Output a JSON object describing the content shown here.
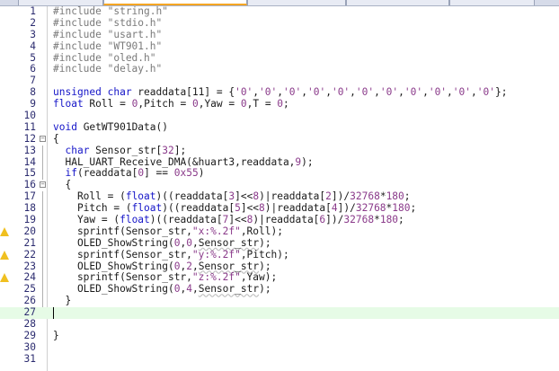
{
  "editor": {
    "lines": [
      {
        "n": "1",
        "tokens": [
          {
            "c": "pp",
            "t": "#include \"string.h\""
          }
        ]
      },
      {
        "n": "2",
        "tokens": [
          {
            "c": "pp",
            "t": "#include \"stdio.h\""
          }
        ]
      },
      {
        "n": "3",
        "tokens": [
          {
            "c": "pp",
            "t": "#include \"usart.h\""
          }
        ]
      },
      {
        "n": "4",
        "tokens": [
          {
            "c": "pp",
            "t": "#include \"WT901.h\""
          }
        ]
      },
      {
        "n": "5",
        "tokens": [
          {
            "c": "pp",
            "t": "#include \"oled.h\""
          }
        ]
      },
      {
        "n": "6",
        "tokens": [
          {
            "c": "pp",
            "t": "#include \"delay.h\""
          }
        ]
      },
      {
        "n": "7",
        "tokens": []
      },
      {
        "n": "8",
        "tokens": [
          {
            "c": "kw",
            "t": "unsigned char "
          },
          {
            "c": "pl",
            "t": "readdata[11] = {"
          },
          {
            "c": "str",
            "t": "'0'"
          },
          {
            "c": "pl",
            "t": ","
          },
          {
            "c": "str",
            "t": "'0'"
          },
          {
            "c": "pl",
            "t": ","
          },
          {
            "c": "str",
            "t": "'0'"
          },
          {
            "c": "pl",
            "t": ","
          },
          {
            "c": "str",
            "t": "'0'"
          },
          {
            "c": "pl",
            "t": ","
          },
          {
            "c": "str",
            "t": "'0'"
          },
          {
            "c": "pl",
            "t": ","
          },
          {
            "c": "str",
            "t": "'0'"
          },
          {
            "c": "pl",
            "t": ","
          },
          {
            "c": "str",
            "t": "'0'"
          },
          {
            "c": "pl",
            "t": ","
          },
          {
            "c": "str",
            "t": "'0'"
          },
          {
            "c": "pl",
            "t": ","
          },
          {
            "c": "str",
            "t": "'0'"
          },
          {
            "c": "pl",
            "t": ","
          },
          {
            "c": "str",
            "t": "'0'"
          },
          {
            "c": "pl",
            "t": ","
          },
          {
            "c": "str",
            "t": "'0'"
          },
          {
            "c": "pl",
            "t": "};"
          }
        ]
      },
      {
        "n": "9",
        "tokens": [
          {
            "c": "kw",
            "t": "float "
          },
          {
            "c": "pl",
            "t": "Roll = "
          },
          {
            "c": "num",
            "t": "0"
          },
          {
            "c": "pl",
            "t": ",Pitch = "
          },
          {
            "c": "num",
            "t": "0"
          },
          {
            "c": "pl",
            "t": ",Yaw = "
          },
          {
            "c": "num",
            "t": "0"
          },
          {
            "c": "pl",
            "t": ",T = "
          },
          {
            "c": "num",
            "t": "0"
          },
          {
            "c": "pl",
            "t": ";"
          }
        ]
      },
      {
        "n": "10",
        "tokens": []
      },
      {
        "n": "11",
        "tokens": [
          {
            "c": "kw",
            "t": "void "
          },
          {
            "c": "pl",
            "t": "GetWT901Data()"
          }
        ]
      },
      {
        "n": "12",
        "fold": "open",
        "tokens": [
          {
            "c": "pl",
            "t": "{"
          }
        ]
      },
      {
        "n": "13",
        "bar": true,
        "tokens": [
          {
            "c": "pl",
            "t": "  "
          },
          {
            "c": "kw",
            "t": "char "
          },
          {
            "c": "pl",
            "t": "Sensor_str["
          },
          {
            "c": "num",
            "t": "32"
          },
          {
            "c": "pl",
            "t": "];"
          }
        ]
      },
      {
        "n": "14",
        "bar": true,
        "tokens": [
          {
            "c": "pl",
            "t": "  HAL_UART_Receive_DMA(&huart3,readdata,"
          },
          {
            "c": "num",
            "t": "9"
          },
          {
            "c": "pl",
            "t": ");"
          }
        ]
      },
      {
        "n": "15",
        "bar": true,
        "tokens": [
          {
            "c": "pl",
            "t": "  "
          },
          {
            "c": "kw",
            "t": "if"
          },
          {
            "c": "pl",
            "t": "(readdata["
          },
          {
            "c": "num",
            "t": "0"
          },
          {
            "c": "pl",
            "t": "] == "
          },
          {
            "c": "num",
            "t": "0x55"
          },
          {
            "c": "pl",
            "t": ")"
          }
        ]
      },
      {
        "n": "16",
        "fold": "open",
        "tokens": [
          {
            "c": "pl",
            "t": "  {"
          }
        ]
      },
      {
        "n": "17",
        "bar": true,
        "tokens": [
          {
            "c": "pl",
            "t": "    Roll = ("
          },
          {
            "c": "kw",
            "t": "float"
          },
          {
            "c": "pl",
            "t": ")((readdata["
          },
          {
            "c": "num",
            "t": "3"
          },
          {
            "c": "pl",
            "t": "]<<"
          },
          {
            "c": "num",
            "t": "8"
          },
          {
            "c": "pl",
            "t": ")|readdata["
          },
          {
            "c": "num",
            "t": "2"
          },
          {
            "c": "pl",
            "t": "])/"
          },
          {
            "c": "num",
            "t": "32768"
          },
          {
            "c": "pl",
            "t": "*"
          },
          {
            "c": "num",
            "t": "180"
          },
          {
            "c": "pl",
            "t": ";"
          }
        ]
      },
      {
        "n": "18",
        "bar": true,
        "tokens": [
          {
            "c": "pl",
            "t": "    Pitch = ("
          },
          {
            "c": "kw",
            "t": "float"
          },
          {
            "c": "pl",
            "t": ")((readdata["
          },
          {
            "c": "num",
            "t": "5"
          },
          {
            "c": "pl",
            "t": "]<<"
          },
          {
            "c": "num",
            "t": "8"
          },
          {
            "c": "pl",
            "t": ")|readdata["
          },
          {
            "c": "num",
            "t": "4"
          },
          {
            "c": "pl",
            "t": "])/"
          },
          {
            "c": "num",
            "t": "32768"
          },
          {
            "c": "pl",
            "t": "*"
          },
          {
            "c": "num",
            "t": "180"
          },
          {
            "c": "pl",
            "t": ";"
          }
        ]
      },
      {
        "n": "19",
        "bar": true,
        "tokens": [
          {
            "c": "pl",
            "t": "    Yaw = ("
          },
          {
            "c": "kw",
            "t": "float"
          },
          {
            "c": "pl",
            "t": ")((readdata["
          },
          {
            "c": "num",
            "t": "7"
          },
          {
            "c": "pl",
            "t": "]<<"
          },
          {
            "c": "num",
            "t": "8"
          },
          {
            "c": "pl",
            "t": ")|readdata["
          },
          {
            "c": "num",
            "t": "6"
          },
          {
            "c": "pl",
            "t": "])/"
          },
          {
            "c": "num",
            "t": "32768"
          },
          {
            "c": "pl",
            "t": "*"
          },
          {
            "c": "num",
            "t": "180"
          },
          {
            "c": "pl",
            "t": ";"
          }
        ]
      },
      {
        "n": "20",
        "bar": true,
        "warn": true,
        "tokens": [
          {
            "c": "pl",
            "t": "    sprintf(Sensor_str,"
          },
          {
            "c": "str",
            "t": "\"x:%.2f\""
          },
          {
            "c": "pl",
            "t": ",Roll);"
          }
        ]
      },
      {
        "n": "21",
        "bar": true,
        "tokens": [
          {
            "c": "pl",
            "t": "    OLED_ShowString("
          },
          {
            "c": "num",
            "t": "0"
          },
          {
            "c": "pl",
            "t": ","
          },
          {
            "c": "num",
            "t": "0"
          },
          {
            "c": "pl",
            "t": ","
          },
          {
            "c": "sq",
            "t": "Sensor_str"
          },
          {
            "c": "pl",
            "t": ");"
          }
        ]
      },
      {
        "n": "22",
        "bar": true,
        "warn": true,
        "tokens": [
          {
            "c": "pl",
            "t": "    sprintf(Sensor_str,"
          },
          {
            "c": "str",
            "t": "\"y:%.2f\""
          },
          {
            "c": "pl",
            "t": ",Pitch);"
          }
        ]
      },
      {
        "n": "23",
        "bar": true,
        "tokens": [
          {
            "c": "pl",
            "t": "    OLED_ShowString("
          },
          {
            "c": "num",
            "t": "0"
          },
          {
            "c": "pl",
            "t": ","
          },
          {
            "c": "num",
            "t": "2"
          },
          {
            "c": "pl",
            "t": ","
          },
          {
            "c": "sq",
            "t": "Sensor_str"
          },
          {
            "c": "pl",
            "t": ");"
          }
        ]
      },
      {
        "n": "24",
        "bar": true,
        "warn": true,
        "tokens": [
          {
            "c": "pl",
            "t": "    sprintf(Sensor_str,"
          },
          {
            "c": "str",
            "t": "\"z:%.2f\""
          },
          {
            "c": "pl",
            "t": ",Yaw);"
          }
        ]
      },
      {
        "n": "25",
        "bar": true,
        "tokens": [
          {
            "c": "pl",
            "t": "    OLED_ShowString("
          },
          {
            "c": "num",
            "t": "0"
          },
          {
            "c": "pl",
            "t": ","
          },
          {
            "c": "num",
            "t": "4"
          },
          {
            "c": "pl",
            "t": ","
          },
          {
            "c": "sq",
            "t": "Sensor_str"
          },
          {
            "c": "pl",
            "t": ");"
          }
        ]
      },
      {
        "n": "26",
        "bar": true,
        "tokens": [
          {
            "c": "pl",
            "t": "  }"
          }
        ]
      },
      {
        "n": "27",
        "current": true,
        "tokens": []
      },
      {
        "n": "28",
        "tokens": []
      },
      {
        "n": "29",
        "tokens": [
          {
            "c": "pl",
            "t": "}"
          }
        ]
      },
      {
        "n": "30",
        "tokens": []
      },
      {
        "n": "31",
        "tokens": []
      }
    ]
  }
}
